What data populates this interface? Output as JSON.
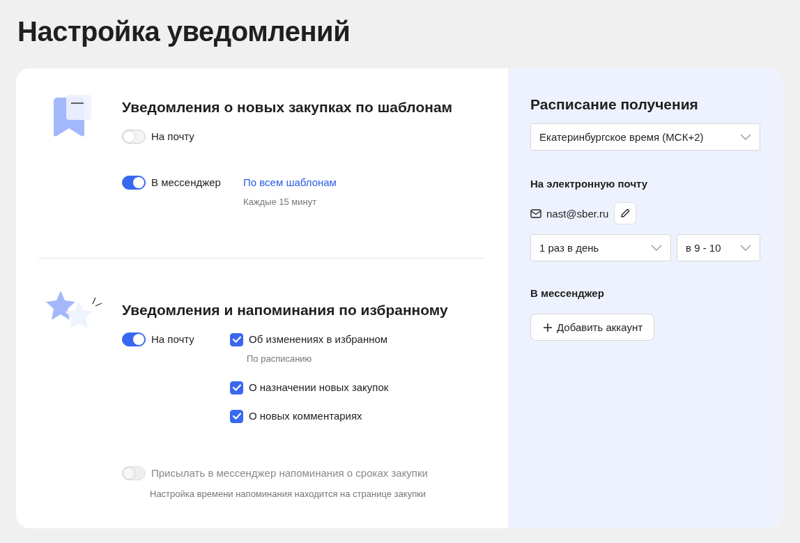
{
  "page_title": "Настройка уведомлений",
  "template_section": {
    "title": "Уведомления о новых закупках по шаблонам",
    "email_toggle": {
      "label": "На почту",
      "on": false,
      "disabled": false
    },
    "messenger_toggle": {
      "label": "В мессенджер",
      "on": true,
      "disabled": false
    },
    "messenger_link": "По всем шаблонам",
    "messenger_hint": "Каждые 15 минут"
  },
  "favorites_section": {
    "title": "Уведомления и напоминания по избранному",
    "email_toggle": {
      "label": "На почту",
      "on": true,
      "disabled": false
    },
    "options": [
      {
        "label": "Об изменениях в избранном",
        "checked": true,
        "hint": "По расписанию"
      },
      {
        "label": "О назначении новых закупок",
        "checked": true
      },
      {
        "label": "О новых комментариях",
        "checked": true
      }
    ],
    "reminder_toggle": {
      "label": "Присылать в мессенджер напоминания о сроках закупки",
      "on": false,
      "disabled": true
    },
    "reminder_hint": "Настройка времени напоминания находится на странице закупки"
  },
  "schedule": {
    "title": "Расписание получения",
    "timezone": "Екатеринбургское время (МСК+2)",
    "email_heading": "На электронную почту",
    "email": "nast@sber.ru",
    "frequency": "1 раз в день",
    "time_range": "в 9 - 10",
    "messenger_heading": "В мессенджер",
    "add_account_button": "Добавить аккаунт"
  }
}
